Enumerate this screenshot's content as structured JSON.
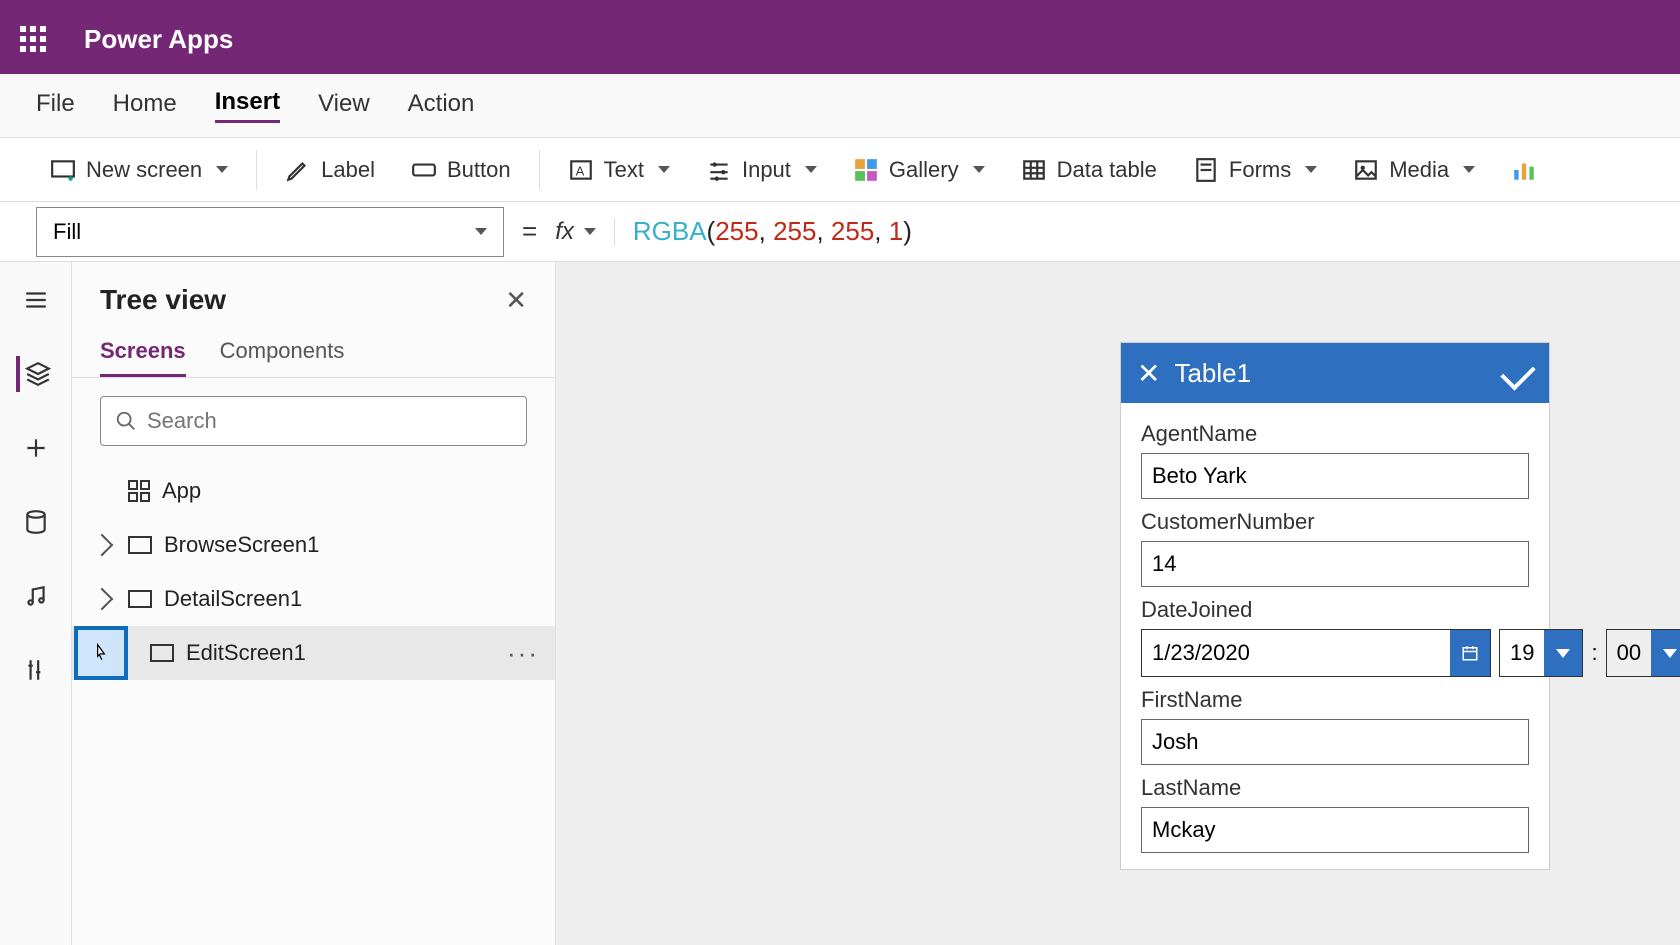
{
  "header": {
    "app_title": "Power Apps"
  },
  "menubar": {
    "items": [
      "File",
      "Home",
      "Insert",
      "View",
      "Action"
    ],
    "active": "Insert"
  },
  "ribbon": {
    "new_screen": "New screen",
    "label": "Label",
    "button": "Button",
    "text": "Text",
    "input": "Input",
    "gallery": "Gallery",
    "data_table": "Data table",
    "forms": "Forms",
    "media": "Media"
  },
  "formula": {
    "property": "Fill",
    "fn": "RGBA",
    "args": [
      "255",
      "255",
      "255",
      "1"
    ]
  },
  "tree": {
    "title": "Tree view",
    "tabs": [
      "Screens",
      "Components"
    ],
    "active_tab": "Screens",
    "search_placeholder": "Search",
    "app_label": "App",
    "items": [
      {
        "label": "BrowseScreen1"
      },
      {
        "label": "DetailScreen1"
      },
      {
        "label": "EditScreen1",
        "selected": true
      }
    ]
  },
  "form": {
    "title": "Table1",
    "fields": {
      "agent_name": {
        "label": "AgentName",
        "value": "Beto Yark"
      },
      "customer_number": {
        "label": "CustomerNumber",
        "value": "14"
      },
      "date_joined": {
        "label": "DateJoined",
        "date": "1/23/2020",
        "hour": "19",
        "minute": "00"
      },
      "first_name": {
        "label": "FirstName",
        "value": "Josh"
      },
      "last_name": {
        "label": "LastName",
        "value": "Mckay"
      }
    }
  }
}
